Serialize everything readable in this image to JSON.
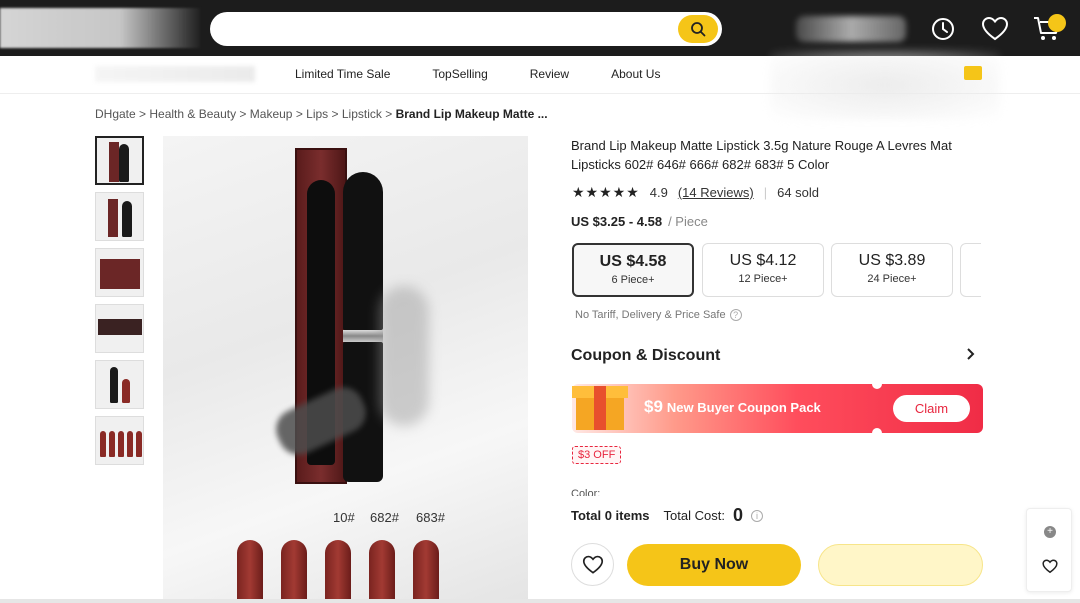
{
  "search": {
    "placeholder": "",
    "value": ""
  },
  "nav": {
    "links": [
      "Limited Time Sale",
      "TopSelling",
      "Review",
      "About Us"
    ]
  },
  "breadcrumb": {
    "items": [
      "DHgate",
      "Health & Beauty",
      "Makeup",
      "Lips",
      "Lipstick"
    ],
    "current": "Brand Lip Makeup Matte ..."
  },
  "product": {
    "title": "Brand Lip Makeup Matte Lipstick 3.5g Nature Rouge A Levres Mat Lipsticks 602# 646# 666# 682# 683# 5 Color",
    "rating": "4.9",
    "stars": "★★★★★",
    "reviews": "(14 Reviews)",
    "sold": "64 sold",
    "price_range": "US $3.25 - 4.58",
    "price_unit": "/ Piece",
    "shade_labels": [
      "10#",
      "682#",
      "683#"
    ]
  },
  "tiers": [
    {
      "price": "US $4.58",
      "qty": "6 Piece+",
      "selected": true
    },
    {
      "price": "US $4.12",
      "qty": "12 Piece+",
      "selected": false
    },
    {
      "price": "US $3.89",
      "qty": "24 Piece+",
      "selected": false
    }
  ],
  "notice": "No Tariff, Delivery & Price Safe",
  "coupon": {
    "title": "Coupon & Discount",
    "banner_amount": "$9",
    "banner_text": "New Buyer Coupon Pack",
    "claim_label": "Claim",
    "off_tag": "$3 OFF"
  },
  "order": {
    "color_label": "Color:",
    "total_items": "Total 0 items",
    "total_cost_label": "Total Cost:",
    "total_cost_value": "0"
  },
  "actions": {
    "buy_now": "Buy Now"
  },
  "colors": {
    "accent": "#f5c518",
    "sale_red": "#e8253e",
    "topbar": "#1c1c1c"
  },
  "icons": [
    "search-icon",
    "history-icon",
    "heart-icon",
    "cart-icon",
    "chevron-right-icon",
    "info-icon",
    "plus-icon",
    "gift-icon"
  ]
}
